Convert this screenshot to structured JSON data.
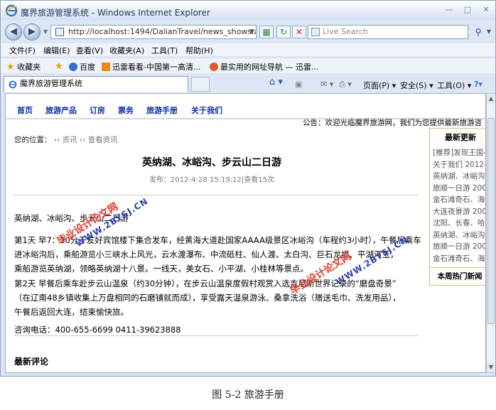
{
  "window": {
    "title": "魔界旅游管理系统 - Windows Internet Explorer",
    "controls": [
      "—",
      "□",
      "✕"
    ]
  },
  "toolbar": {
    "url": "http://localhost:1494/DalianTravel/news_shows.aspx?Nid=",
    "search_placeholder": "Live Search"
  },
  "menu": [
    "文件(F)",
    "编辑(E)",
    "查看(V)",
    "收藏夹(A)",
    "工具(T)",
    "帮助(H)"
  ],
  "favorites": {
    "label": "收藏夹",
    "items": [
      "百度",
      "迅雷看看-中国第一高清...",
      "最实用的网址导航 — 迅雷..."
    ]
  },
  "tab": {
    "title": "魔界旅游管理系统"
  },
  "commands": [
    "页面(P)",
    "安全(S)",
    "工具(O)"
  ],
  "site": {
    "nav": [
      "首页",
      "旅游产品",
      "订房",
      "票务",
      "旅游手册",
      "关于我们"
    ],
    "notice": "公告：欢迎光临魔界旅游网，我们为您提供最新旅游咨",
    "breadcrumb": {
      "label": "您的位置：",
      "sep1": "››",
      "item1": "资讯",
      "sep2": "››",
      "item2": "查看资讯"
    }
  },
  "article": {
    "title": "英纳湖、冰峪沟、步云山二日游",
    "meta": "发布：2012-4-28 15:19:12|查看15次",
    "subtitle": "英纳湖、冰峪沟、步云山二日游",
    "day1_lines": [
      "第1天 早7：30分于友好宾馆楼下集合发车，经黄海大道赴国家AAAA级景区冰峪沟（车程约3小时），午餐后乘车",
      "进冰峪沟后，乘船游览小三峡水上风光，云水渡瀑布、中流砥柱、仙人渡、太白沟、巨石龙坝、平湖泻玉，",
      "乘船游览英纳湖，领略英纳湖十八景。一线天，美女石、小平湖、小桂林等景点。"
    ],
    "day2_lines": [
      "第2天 早餐后乘车赴步云山温泉（约30分钟），在步云山温泉度假村观赏入选吉尼斯世界记录的“磨盘奇景”",
      "（在辽南48乡镇收集上万盘相同的石磨铺就而成），享受露天温泉游泳、桑拿洗浴（赠送毛巾、洗发用品），",
      "午餐后返回大连，结束愉快旅。"
    ],
    "contact": "咨询电话：400-655-6699 0411-39623888"
  },
  "comments": {
    "heading": "最新评论"
  },
  "sidebar": {
    "heading": "最新更新",
    "items": [
      "[推荐]发现王国-",
      "关于我们 2012-3",
      "英纳湖、冰峪沟",
      "旅顺一日游 200",
      "金石滩奇石、海",
      "大连夜景游 200",
      "沈阳、长春、哈",
      "英纳湖、冰峪沟",
      "旅顺一日游 200",
      "金石滩奇石、海"
    ],
    "heading2": "本周热门新闻"
  },
  "watermarks": {
    "cn_text": "毕业设计论文网",
    "url_text": "WWW.2BYSJ.CN"
  },
  "caption": "图 5-2 旅游手册",
  "colors": {
    "nav_link": "#0d2fa0",
    "watermark_red": "#e63a2e",
    "watermark_blue": "#2b3fb0",
    "chrome_bg": "#dce6f4"
  }
}
